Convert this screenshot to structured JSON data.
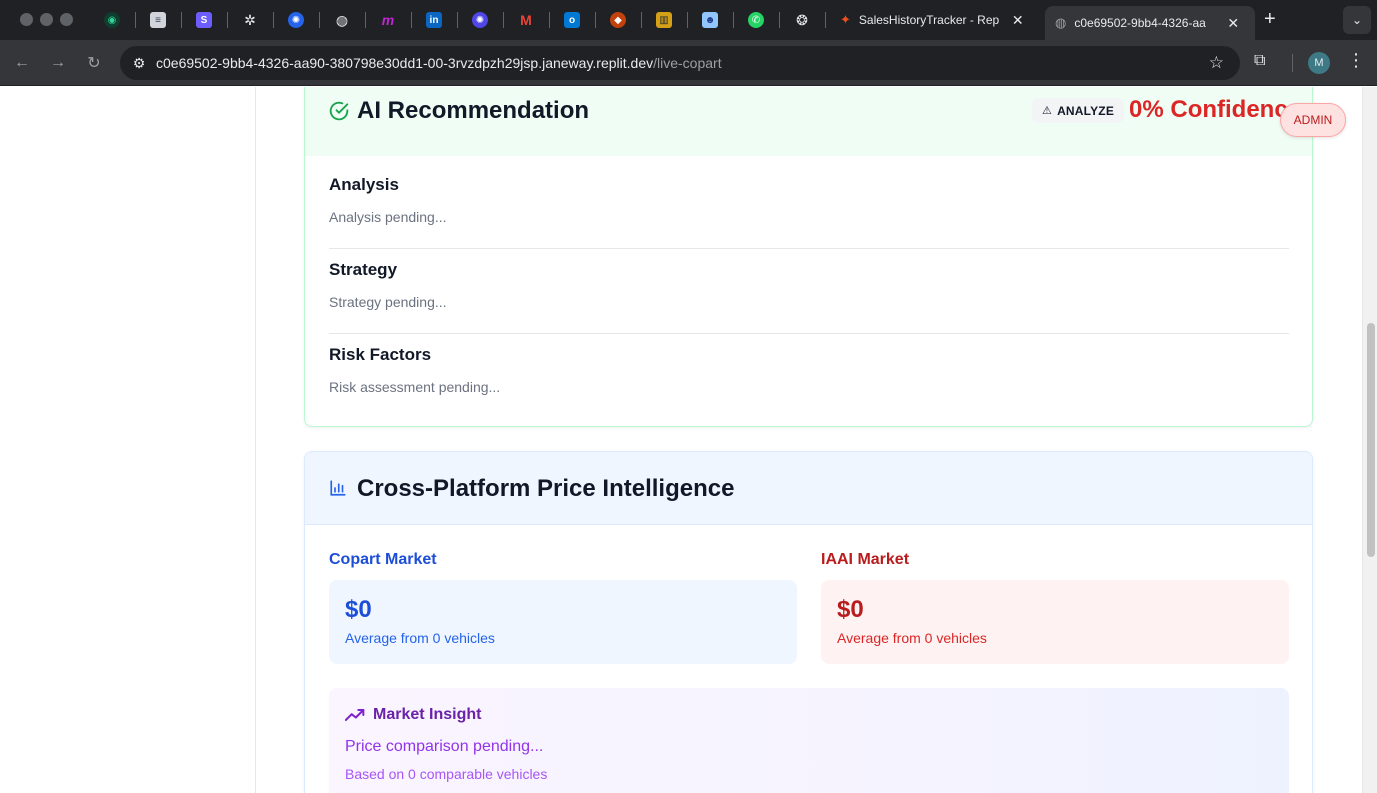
{
  "browser": {
    "tabs": [
      {
        "title": "SalesHistoryTracker - Rep",
        "close": "✕"
      },
      {
        "title": "c0e69502-9bb4-4326-aa",
        "close": "✕"
      }
    ],
    "new_tab": "+",
    "url_host": "c0e69502-9bb4-4326-aa90-380798e30dd1-00-3rvzdpzh29jsp.janeway.replit.dev",
    "url_path": "/live-copart",
    "profile_initial": "M"
  },
  "ai_recommendation": {
    "title": "AI Recommendation",
    "badge": "ANALYZE",
    "confidence": "0% Confidence",
    "sections": [
      {
        "label": "Analysis",
        "value": "Analysis pending..."
      },
      {
        "label": "Strategy",
        "value": "Strategy pending..."
      },
      {
        "label": "Risk Factors",
        "value": "Risk assessment pending..."
      }
    ]
  },
  "price_intelligence": {
    "title": "Cross-Platform Price Intelligence",
    "copart": {
      "label": "Copart Market",
      "amount": "$0",
      "sub": "Average from 0 vehicles"
    },
    "iaai": {
      "label": "IAAI Market",
      "amount": "$0",
      "sub": "Average from 0 vehicles"
    },
    "insight": {
      "title": "Market Insight",
      "pending": "Price comparison pending...",
      "based": "Based on 0 comparable vehicles"
    }
  },
  "admin_button": "ADMIN",
  "colors": {
    "green_accent": "#16a34a",
    "red_accent": "#dc2626",
    "blue_accent": "#1d4ed8",
    "purple_accent": "#9333ea"
  }
}
